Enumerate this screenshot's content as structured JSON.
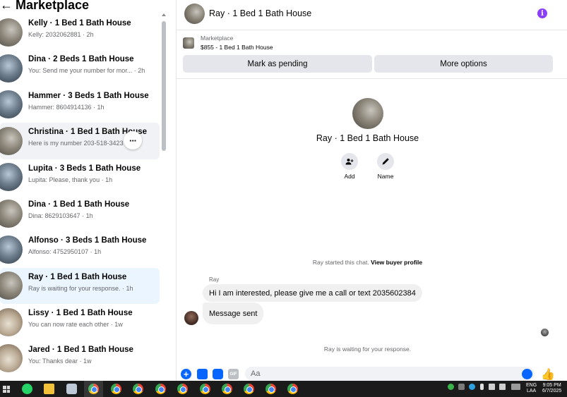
{
  "left_panel": {
    "title": "Marketplace",
    "conversations": [
      {
        "title": "Kelly · 1 Bed 1 Bath House",
        "subtitle": "Kelly: 2032062881 · 2h"
      },
      {
        "title": "Dina · 2 Beds 1 Bath House",
        "subtitle": "You: Send me your number for mor... · 2h"
      },
      {
        "title": "Hammer · 3 Beds 1 Bath House",
        "subtitle": "Hammer: 8604914136 · 1h"
      },
      {
        "title": "Christina · 1 Bed 1 Bath House",
        "subtitle": "Here is my number 203-518-3423 ·"
      },
      {
        "title": "Lupita · 3 Beds 1 Bath House",
        "subtitle": "Lupita: Please, thank you · 1h"
      },
      {
        "title": "Dina · 1 Bed 1 Bath House",
        "subtitle": "Dina: 8629103647 · 1h"
      },
      {
        "title": "Alfonso · 3 Beds 1 Bath House",
        "subtitle": "Alfonso: 4752950107 · 1h"
      },
      {
        "title": "Ray · 1 Bed 1 Bath House",
        "subtitle": "Ray is waiting for your response. · 1h"
      },
      {
        "title": "Lissy · 1 Bed 1 Bath House",
        "subtitle": "You can now rate each other · 1w"
      },
      {
        "title": "Jared · 1 Bed 1 Bath House",
        "subtitle": "You: Thanks dear · 1w"
      }
    ],
    "more_glyph": "···"
  },
  "chat": {
    "header_title": "Ray · 1 Bed 1 Bath House",
    "info_glyph": "i",
    "listing": {
      "source": "Marketplace",
      "price_title": "$855 - 1 Bed 1 Bath House",
      "mark_pending_label": "Mark as pending",
      "more_options_label": "More options"
    },
    "profile_name": "Ray · 1 Bed 1 Bath House",
    "actions": {
      "add_label": "Add",
      "name_label": "Name"
    },
    "started_text": "Ray started this chat.",
    "view_profile_link": "View buyer profile",
    "sender_name": "Ray",
    "messages": [
      {
        "text": "Hi I am interested, please give me a call or text 2035602384"
      },
      {
        "text": "Message sent"
      }
    ],
    "waiting_text": "Ray is waiting for your response.",
    "composer": {
      "placeholder": "Aa",
      "plus_glyph": "+",
      "gif_label": "GIF",
      "like_glyph": "👍"
    }
  },
  "taskbar": {
    "language_top": "ENG",
    "language_bottom": "LAA",
    "time": "9:05 PM",
    "date": "6/7/2025"
  },
  "colors": {
    "accent": "#0866ff",
    "selected_bg": "#ebf5ff",
    "button_bg": "#e4e6eb",
    "info_purple": "#8a3ffc"
  }
}
